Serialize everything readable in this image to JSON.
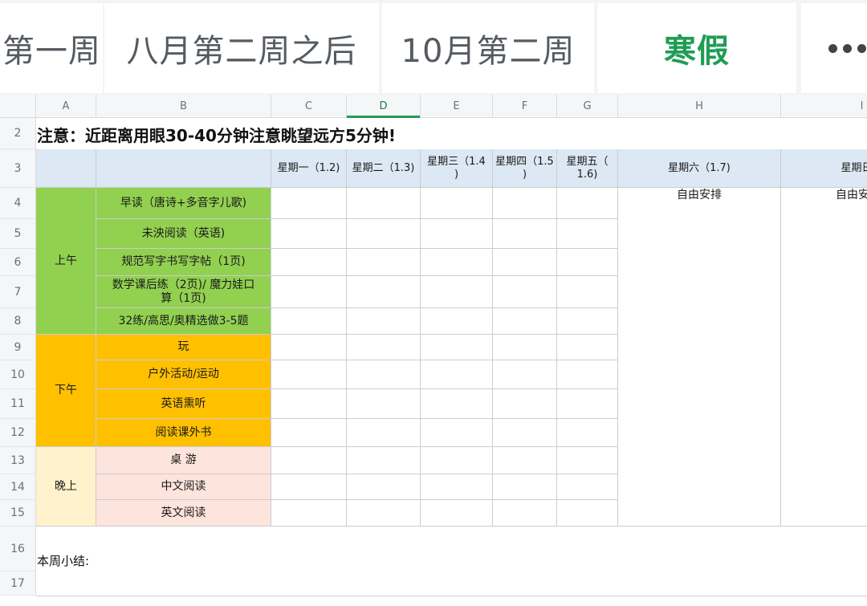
{
  "tabs": [
    {
      "label": "第一周",
      "active": false
    },
    {
      "label": "八月第二周之后",
      "active": false
    },
    {
      "label": "10月第二周",
      "active": false
    },
    {
      "label": "寒假",
      "active": true
    }
  ],
  "more_icon": "more-horizontal-icon",
  "columns": [
    "A",
    "B",
    "C",
    "D",
    "E",
    "F",
    "G",
    "H",
    "I"
  ],
  "selected_column": "D",
  "rows": [
    "2",
    "3",
    "4",
    "5",
    "6",
    "7",
    "8",
    "9",
    "10",
    "11",
    "12",
    "13",
    "14",
    "15",
    "16",
    "17"
  ],
  "notice": "注意：近距离用眼30-40分钟注意眺望远方5分钟!",
  "day_headers": [
    "星期一（1.2)",
    "星期二（1.3)",
    "星期三（1.4\n)",
    "星期四（1.5\n)",
    "星期五（\n1.6)",
    "星期六（1.7)",
    "星期日（"
  ],
  "weekend_note": [
    "自由安排",
    "自由安"
  ],
  "sections": [
    {
      "name": "上午",
      "tasks": [
        "早读（唐诗+多音字儿歌)",
        "未泱阅读（英语)",
        "规范写字书写字帖（1页)",
        "数学课后练（2页)/    魔力娃口\n算（1页)",
        "32练/高思/奥精选做3-5题"
      ]
    },
    {
      "name": "下午",
      "tasks": [
        "玩",
        "户外活动/运动",
        "英语熏听",
        "阅读课外书"
      ]
    },
    {
      "name": "晚上",
      "tasks": [
        "桌  游",
        "中文阅读",
        "英文阅读"
      ]
    }
  ],
  "summary_label": "本周小结:",
  "colors": {
    "active_tab": "#1f9d55",
    "header_fill": "#dce8f3",
    "morning_fill": "#92d050",
    "afternoon_fill": "#ffc000",
    "evening_label_fill": "#fff2cc",
    "evening_task_fill": "#fde4dc"
  }
}
